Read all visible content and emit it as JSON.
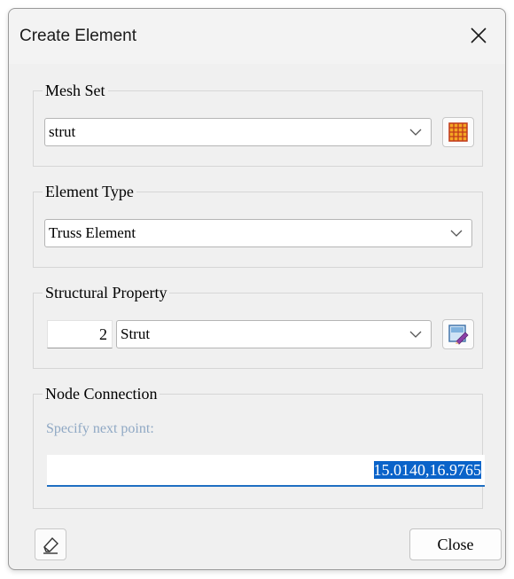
{
  "dialog": {
    "title": "Create Element"
  },
  "mesh_set": {
    "legend": "Mesh Set",
    "value": "strut"
  },
  "element_type": {
    "legend": "Element Type",
    "value": "Truss Element"
  },
  "structural_property": {
    "legend": "Structural Property",
    "id": "2",
    "value": "Strut"
  },
  "node_connection": {
    "legend": "Node Connection",
    "prompt": "Specify next point:",
    "coordinates": "15.0140,16.9765"
  },
  "footer": {
    "close_label": "Close"
  },
  "icons": {
    "close": "close-x-icon",
    "mesh": "mesh-grid-icon",
    "property": "property-edit-icon",
    "eraser": "eraser-icon",
    "dropdown": "chevron-down-icon"
  },
  "colors": {
    "selection": "#0a63c9",
    "input_underline": "#1f6fc2",
    "prompt_text": "#8fa8c4",
    "mesh_icon": "#e8781a"
  }
}
